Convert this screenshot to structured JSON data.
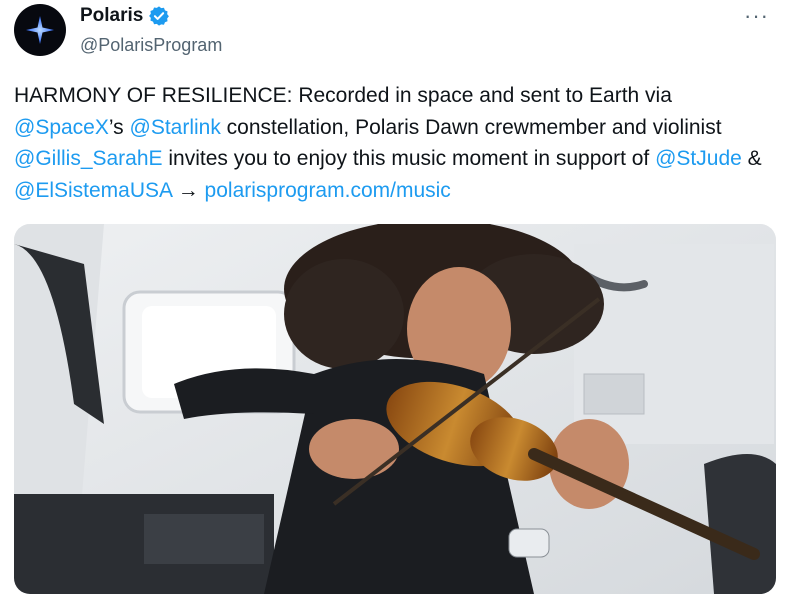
{
  "author": {
    "name": "Polaris",
    "handle": "@PolarisProgram",
    "verified_color": "#1d9bf0"
  },
  "more_label": "···",
  "tweet": {
    "seg1": "HARMONY OF RESILIENCE: Recorded in space and sent to Earth via ",
    "mention_spacex": "@SpaceX",
    "seg2": "’s ",
    "mention_starlink": "@Starlink",
    "seg3": " constellation, Polaris Dawn crewmember and violinist ",
    "mention_gillis": "@Gillis_SarahE",
    "seg4": " invites you to enjoy this music moment in support of ",
    "mention_stjude": "@StJude",
    "seg5": " & ",
    "mention_elsistema": "@ElSistemaUSA",
    "seg6": " → ",
    "link_url": "polarisprogram.com/music"
  },
  "colors": {
    "link": "#1d9bf0",
    "text": "#0f1419",
    "secondary": "#536471"
  },
  "media": {
    "kind": "video",
    "icons": [
      "star-logo-icon",
      "verified-badge-icon",
      "more-icon"
    ]
  }
}
